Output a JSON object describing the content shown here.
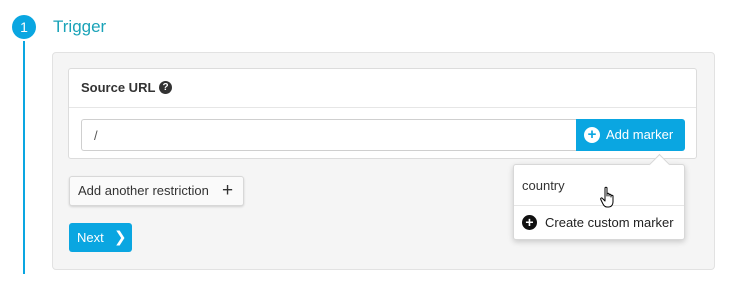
{
  "step": {
    "number": "1",
    "title": "Trigger"
  },
  "source_url": {
    "label": "Source URL",
    "help_icon": "question-circle-icon",
    "input_value": "/",
    "add_marker_label": "Add marker"
  },
  "marker_dropdown": {
    "items": [
      {
        "label": "country"
      },
      {
        "label": "Create custom marker",
        "icon": "plus-circle-icon"
      }
    ]
  },
  "actions": {
    "add_restriction_label": "Add another restriction",
    "next_label": "Next"
  },
  "colors": {
    "accent": "#0aa6e1",
    "step_title": "#1aa3b8",
    "panel_bg": "#f5f5f5"
  }
}
